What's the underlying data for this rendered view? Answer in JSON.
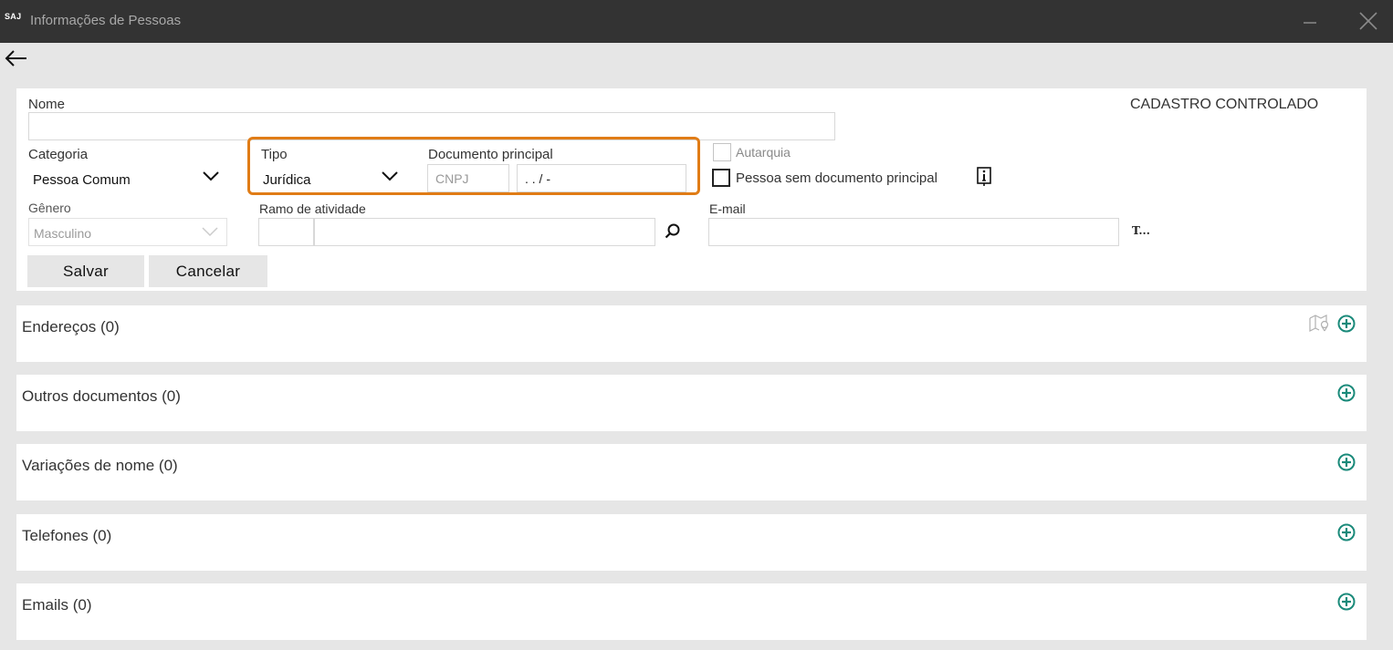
{
  "window": {
    "logo": "SAJ",
    "title": "Informações de Pessoas"
  },
  "form": {
    "nome_label": "Nome",
    "nome_value": "",
    "cadastro_status": "CADASTRO CONTROLADO",
    "categoria_label": "Categoria",
    "categoria_value": "Pessoa Comum",
    "tipo_label": "Tipo",
    "tipo_value": "Jurídica",
    "documento_label": "Documento principal",
    "documento_tipo": "CNPJ",
    "documento_mask": " .  .  /  -",
    "autarquia_label": "Autarquia",
    "sem_documento_label": "Pessoa sem documento principal",
    "genero_label": "Gênero",
    "genero_value": "Masculino",
    "ramo_label": "Ramo de atividade",
    "email_label": "E-mail",
    "email_suffix": "T...",
    "salvar_label": "Salvar",
    "cancelar_label": "Cancelar"
  },
  "sections": [
    {
      "title": "Endereços (0)"
    },
    {
      "title": "Outros documentos (0)"
    },
    {
      "title": "Variações de nome (0)"
    },
    {
      "title": "Telefones (0)"
    },
    {
      "title": "Emails (0)"
    }
  ],
  "colors": {
    "titlebar": "#333333",
    "highlight": "#e07c16",
    "add_icon": "#1a8a7a",
    "background": "#e6e6e6"
  },
  "icons": {
    "back": "arrow-left-icon",
    "minimize": "minimize-icon",
    "close": "close-icon",
    "chevron": "chevron-down-icon",
    "search": "search-icon",
    "info": "info-icon",
    "map": "map-pin-icon",
    "add": "plus-circle-icon"
  }
}
